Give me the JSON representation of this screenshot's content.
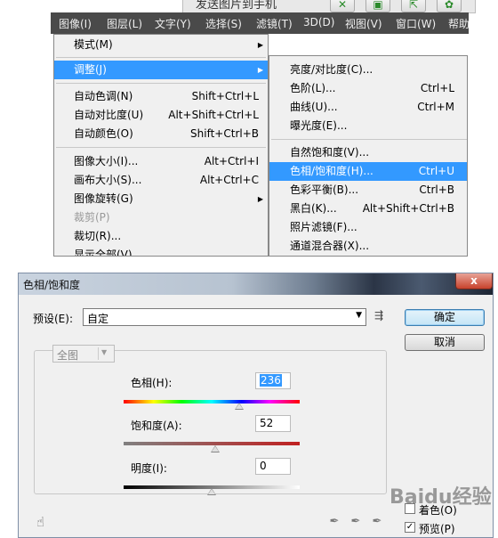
{
  "toolbar": {
    "send_text": "发送图片到手机",
    "icons": [
      "share-icon",
      "save-icon",
      "export-icon",
      "settings-icon"
    ]
  },
  "menubar": {
    "items": [
      "图像(I)",
      "图层(L)",
      "文字(Y)",
      "选择(S)",
      "滤镜(T)",
      "3D(D)",
      "视图(V)",
      "窗口(W)",
      "帮助"
    ]
  },
  "image_menu": {
    "items": [
      {
        "label": "模式(M)",
        "shortcut": "",
        "submenu": true
      },
      {
        "label": "调整(J)",
        "shortcut": "",
        "submenu": true,
        "highlighted": true
      },
      {
        "label": "自动色调(N)",
        "shortcut": "Shift+Ctrl+L"
      },
      {
        "label": "自动对比度(U)",
        "shortcut": "Alt+Shift+Ctrl+L"
      },
      {
        "label": "自动颜色(O)",
        "shortcut": "Shift+Ctrl+B"
      },
      {
        "label": "图像大小(I)...",
        "shortcut": "Alt+Ctrl+I"
      },
      {
        "label": "画布大小(S)...",
        "shortcut": "Alt+Ctrl+C"
      },
      {
        "label": "图像旋转(G)",
        "shortcut": "",
        "submenu": true
      },
      {
        "label": "裁剪(P)",
        "shortcut": "",
        "disabled": true
      },
      {
        "label": "裁切(R)...",
        "shortcut": ""
      },
      {
        "label": "显示全部(V)",
        "shortcut": ""
      }
    ]
  },
  "adjust_menu": {
    "items": [
      {
        "label": "亮度/对比度(C)...",
        "shortcut": ""
      },
      {
        "label": "色阶(L)...",
        "shortcut": "Ctrl+L"
      },
      {
        "label": "曲线(U)...",
        "shortcut": "Ctrl+M"
      },
      {
        "label": "曝光度(E)...",
        "shortcut": ""
      },
      {
        "label": "自然饱和度(V)...",
        "shortcut": ""
      },
      {
        "label": "色相/饱和度(H)...",
        "shortcut": "Ctrl+U",
        "highlighted": true
      },
      {
        "label": "色彩平衡(B)...",
        "shortcut": "Ctrl+B"
      },
      {
        "label": "黑白(K)...",
        "shortcut": "Alt+Shift+Ctrl+B"
      },
      {
        "label": "照片滤镜(F)...",
        "shortcut": ""
      },
      {
        "label": "通道混合器(X)...",
        "shortcut": ""
      }
    ]
  },
  "dialog": {
    "title": "色相/饱和度",
    "close_label": "x",
    "preset_label": "预设(E):",
    "preset_value": "自定",
    "ok_label": "确定",
    "cancel_label": "取消",
    "channel_value": "全图",
    "hue_label": "色相(H):",
    "hue_value": "236",
    "saturation_label": "饱和度(A):",
    "saturation_value": "52",
    "lightness_label": "明度(I):",
    "lightness_value": "0",
    "colorize_label": "着色(O)",
    "colorize_checked": false,
    "preview_label": "预览(P)",
    "preview_checked": true
  },
  "watermark": "Baidu经验",
  "colors": {
    "highlight": "#3399ff",
    "menubar": "#4a4a4a"
  }
}
